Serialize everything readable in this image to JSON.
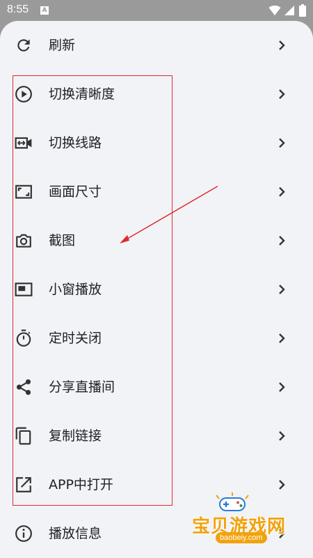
{
  "status_bar": {
    "time": "8:55",
    "notification_letter": "A"
  },
  "menu": {
    "items": [
      {
        "label": "刷新",
        "icon": "refresh-icon"
      },
      {
        "label": "切换清晰度",
        "icon": "play-circle-icon"
      },
      {
        "label": "切换线路",
        "icon": "video-switch-icon"
      },
      {
        "label": "画面尺寸",
        "icon": "aspect-ratio-icon"
      },
      {
        "label": "截图",
        "icon": "camera-icon"
      },
      {
        "label": "小窗播放",
        "icon": "picture-in-picture-icon"
      },
      {
        "label": "定时关闭",
        "icon": "timer-icon"
      },
      {
        "label": "分享直播间",
        "icon": "share-icon"
      },
      {
        "label": "复制链接",
        "icon": "copy-icon"
      },
      {
        "label": "APP中打开",
        "icon": "open-external-icon"
      },
      {
        "label": "播放信息",
        "icon": "info-icon"
      }
    ]
  },
  "annotation": {
    "color": "#e02b2b"
  },
  "watermark": {
    "title": "宝贝游戏网",
    "url": "baobeiy.com",
    "color": "#f2a20c"
  }
}
